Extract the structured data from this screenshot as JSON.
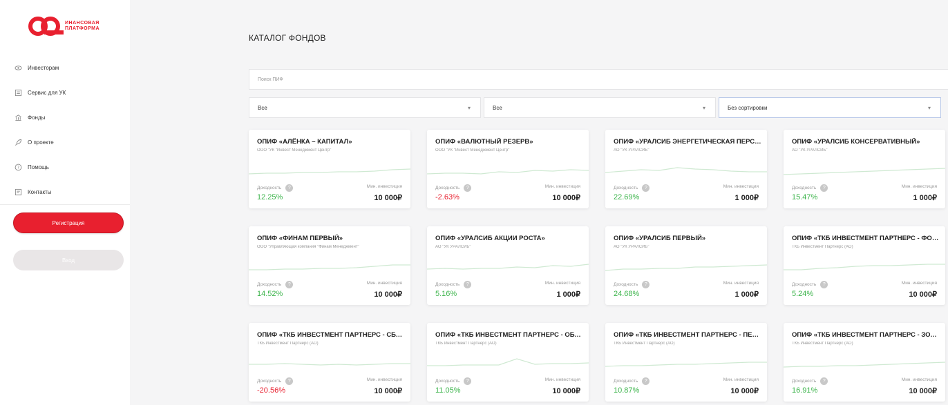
{
  "brand": {
    "logo_text_line1": "ИНАНСОВАЯ",
    "logo_text_line2": "ПЛАТФОРМА",
    "accent": "#e8202f"
  },
  "nav": [
    {
      "label": "Инвесторам",
      "icon": "investors-icon"
    },
    {
      "label": "Сервис для УК",
      "icon": "service-icon"
    },
    {
      "label": "Фонды",
      "icon": "funds-icon"
    },
    {
      "label": "О проекте",
      "icon": "rocket-icon"
    },
    {
      "label": "Помощь",
      "icon": "help-circle-icon"
    },
    {
      "label": "Контакты",
      "icon": "contacts-icon"
    }
  ],
  "auth": {
    "register_label": "Регистрация",
    "login_label": "Вход"
  },
  "page": {
    "title": "КАТАЛОГ ФОНДОВ"
  },
  "search": {
    "placeholder": "Поиск ПИФ"
  },
  "filters": {
    "type": "Все",
    "company": "Все",
    "sort": "Без сортировки"
  },
  "labels": {
    "yield": "Доходность",
    "min_invest": "Мин. инвестиция"
  },
  "colors": {
    "positive": "#3cb44b",
    "negative": "#e8202f",
    "spark": "#cfe9d2"
  },
  "funds": [
    {
      "title": "ОПИФ «АЛЁНКА – КАПИТАЛ»",
      "company": "ООО \"УК \"Инвест Менеджмент Центр\"",
      "yield": "12.25%",
      "positive": true,
      "min": "10 000₽",
      "spark": [
        20,
        19,
        19,
        18,
        18,
        17,
        17,
        16,
        14,
        13
      ]
    },
    {
      "title": "ОПИФ «ВАЛЮТНЫЙ РЕЗЕРВ»",
      "company": "ООО \"УК \"Инвест Менеджмент Центр\"",
      "yield": "-2.63%",
      "positive": false,
      "min": "10 000₽",
      "spark": [
        20,
        19,
        19,
        20,
        17,
        18,
        15,
        16,
        14,
        15
      ]
    },
    {
      "title": "ОПИФ «УРАЛСИБ ЭНЕРГЕТИЧЕСКАЯ ПЕРСПЕКТИВА»",
      "company": "АО \"УК УРАЛСИБ\"",
      "yield": "22.69%",
      "positive": true,
      "min": "1 000₽",
      "spark": [
        18,
        16,
        14,
        15,
        11,
        13,
        14,
        16,
        17,
        17
      ]
    },
    {
      "title": "ОПИФ «УРАЛСИБ КОНСЕРВАТИВНЫЙ»",
      "company": "АО \"УК УРАЛСИБ\"",
      "yield": "15.47%",
      "positive": true,
      "min": "1 000₽",
      "spark": [
        21,
        20,
        19,
        18,
        17,
        16,
        15,
        14,
        13,
        12
      ]
    },
    {
      "title": "ОПИФ «ФИНАМ ПЕРВЫЙ»",
      "company": "ООО \"Управляющая компания \"Финам Менеджмент\"",
      "yield": "14.52%",
      "positive": true,
      "min": "10 000₽",
      "spark": [
        19,
        19,
        18,
        18,
        17,
        17,
        16,
        14,
        12,
        12
      ]
    },
    {
      "title": "ОПИФ «УРАЛСИБ АКЦИИ РОСТА»",
      "company": "АО \"УК УРАЛСИБ\"",
      "yield": "5.16%",
      "positive": true,
      "min": "1 000₽",
      "spark": [
        18,
        17,
        18,
        17,
        17,
        15,
        16,
        13,
        14,
        11
      ]
    },
    {
      "title": "ОПИФ «УРАЛСИБ ПЕРВЫЙ»",
      "company": "АО \"УК УРАЛСИБ\"",
      "yield": "24.68%",
      "positive": true,
      "min": "1 000₽",
      "spark": [
        20,
        18,
        18,
        17,
        17,
        15,
        15,
        14,
        13,
        12
      ]
    },
    {
      "title": "ОПИФ «ТКБ ИНВЕСТМЕНТ ПАРТНЕРС - ФОНД АКЦИЙ»",
      "company": "ТКБ Инвестмент Партнерс (АО)",
      "yield": "5.24%",
      "positive": true,
      "min": "10 000₽",
      "spark": [
        19,
        19,
        17,
        16,
        14,
        13,
        13,
        12,
        11,
        11
      ]
    },
    {
      "title": "ОПИФ «ТКБ ИНВЕСТМЕНТ ПАРТНЕРС - СБАЛАНСИРОВАННЫЙ»",
      "company": "ТКБ Инвестмент Партнерс (АО)",
      "yield": "-20.56%",
      "positive": false,
      "min": "10 000₽",
      "spark": [
        16,
        16,
        15,
        16,
        17,
        16,
        17,
        16,
        15,
        15
      ]
    },
    {
      "title": "ОПИФ «ТКБ ИНВЕСТМЕНТ ПАРТНЕРС - ОБЛИГАЦИИ»",
      "company": "ТКБ Инвестмент Партнерс (АО)",
      "yield": "11.05%",
      "positive": true,
      "min": "10 000₽",
      "spark": [
        18,
        18,
        17,
        17,
        17,
        8,
        16,
        15,
        15,
        14
      ]
    },
    {
      "title": "ОПИФ «ТКБ ИНВЕСТМЕНТ ПАРТНЕРС - ПЕРВЫЙ»",
      "company": "ТКБ Инвестмент Партнерс (АО)",
      "yield": "10.87%",
      "positive": true,
      "min": "10 000₽",
      "spark": [
        19,
        18,
        18,
        17,
        16,
        16,
        15,
        14,
        13,
        13
      ]
    },
    {
      "title": "ОПИФ «ТКБ ИНВЕСТМЕНТ ПАРТНЕРС - ЗОЛОТОЙ»",
      "company": "ТКБ Инвестмент Партнерс (АО)",
      "yield": "16.91%",
      "positive": true,
      "min": "10 000₽",
      "spark": [
        20,
        19,
        19,
        18,
        18,
        17,
        16,
        15,
        14,
        13
      ]
    }
  ]
}
